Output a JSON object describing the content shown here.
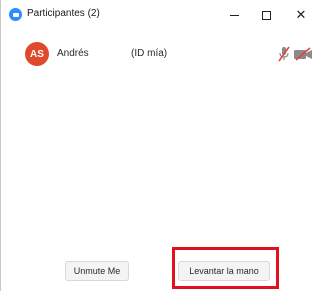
{
  "window": {
    "title": "Participantes (2)",
    "controls": {
      "minimize": "–",
      "close": "✕"
    }
  },
  "participants": [
    {
      "initials": "AS",
      "name": "Andrés",
      "tag": "(ID mía)",
      "avatar_color": "#e04a2b",
      "mic_icon": "mic-muted-icon",
      "video_icon": "video-off-icon"
    }
  ],
  "buttons": {
    "unmute": "Unmute Me",
    "raise_hand": "Levantar la mano"
  },
  "colors": {
    "accent": "#2d8cff",
    "highlight": "#e0111f",
    "muted_icon": "#e0443c"
  }
}
